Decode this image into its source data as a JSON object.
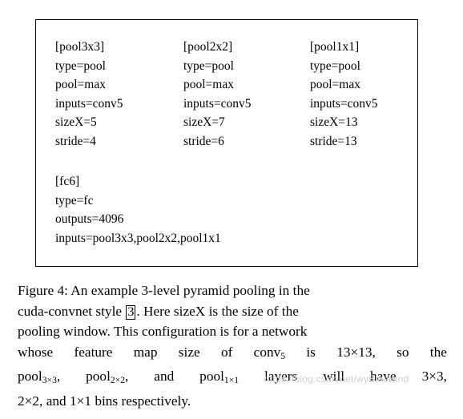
{
  "figure": {
    "columns": [
      {
        "name": "pool3x3",
        "lines": [
          "[pool3x3]",
          "type=pool",
          "pool=max",
          "inputs=conv5",
          "sizeX=5",
          "stride=4"
        ]
      },
      {
        "name": "pool2x2",
        "lines": [
          "[pool2x2]",
          "type=pool",
          "pool=max",
          "inputs=conv5",
          "sizeX=7",
          "stride=6"
        ]
      },
      {
        "name": "pool1x1",
        "lines": [
          "[pool1x1]",
          "type=pool",
          "pool=max",
          "inputs=conv5",
          "sizeX=13",
          "stride=13"
        ]
      }
    ],
    "fc_block": {
      "name": "fc6",
      "lines": [
        "[fc6]",
        "type=fc",
        "outputs=4096",
        "inputs=pool3x3,pool2x2,pool1x1"
      ]
    }
  },
  "caption": {
    "line1": "Figure 4: An example 3-level pyramid pooling in the",
    "line2_a": "cuda-convnet",
    "line2_b": "style",
    "line2_cite": "3",
    "line2_c": ". Here sizeX is the size of the",
    "line3": "pooling window. This configuration is for a network",
    "line4_a": "whose",
    "line4_b": "feature",
    "line4_c": "map",
    "line4_d": "size",
    "line4_e": "of",
    "line4_f": "conv",
    "line4_sub": "5",
    "line4_g": "is",
    "line4_h": "13×13,",
    "line4_i": "so",
    "line4_j": "the",
    "line5_a": "pool",
    "line5_sub1": "3×3",
    "line5_b": ",",
    "line5_c": "pool",
    "line5_sub2": "2×2",
    "line5_d": ",",
    "line5_e": "and",
    "line5_f": "pool",
    "line5_sub3": "1×1",
    "line5_g": "layers",
    "line5_h": "will",
    "line5_i": "have",
    "line5_j": "3×3,",
    "line6_a": "2×2,",
    "line6_b": "and",
    "line6_c": "1×1",
    "line6_d": "bins",
    "line6_e": "respectively."
  },
  "watermark": {
    "text": "https://blog.csdn.net/wyBluewind"
  }
}
